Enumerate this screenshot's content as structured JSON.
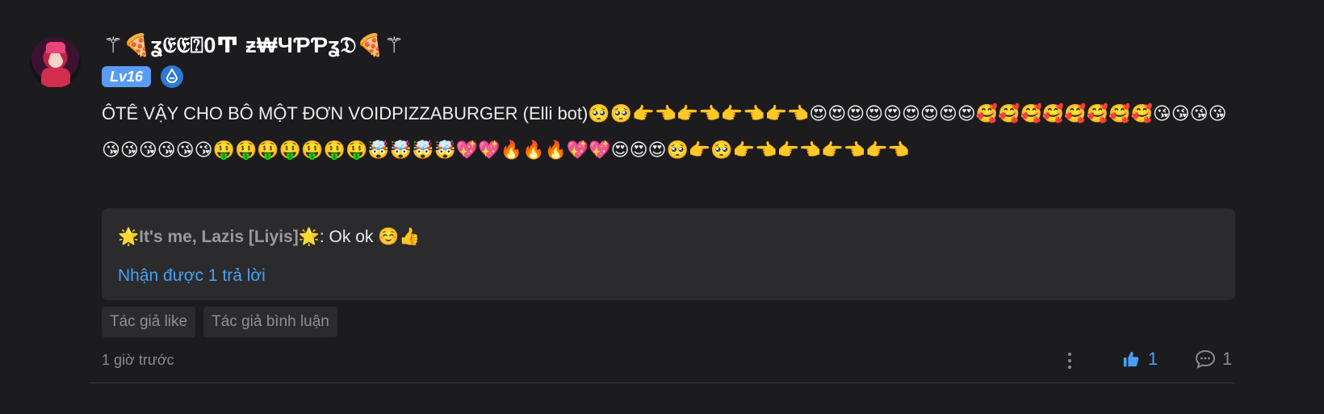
{
  "comment": {
    "username": "⚚🍕ʓ𝔈𝔈⍰0Ͳ ƶ₩ЧƤƤʓ𝔇🍕⚚",
    "level": "Lv16",
    "content": "ÔTÊ VẬY CHO BÔ MỘT ĐƠN VOIDPIZZABURGER (Elli bot)🥺🥺👉👈👉👈👉👈👉👈😍😍😍😍😍😍😍😍😍🥰🥰🥰🥰🥰🥰🥰🥰😘😘😘😘😘😘😘😘😘😘🤑🤑🤑🤑🤑🤑🤑🤯🤯🤯🤯💖💖🔥🔥🔥💖💖😍😍😍🥺👉🥺👉👈👉👈👉👈👉👈",
    "quote": {
      "author": "🌟It's me, Lazis [Liyis]🌟",
      "separator": ": ",
      "text": "Ok ok ☺️👍",
      "replies_link": "Nhận được 1 trả lời"
    },
    "tags": [
      "Tác giả like",
      "Tác giả bình luận"
    ],
    "time": "1 giờ trước",
    "likes": "1",
    "replies": "1"
  },
  "icons": {
    "verified": "verified-icon",
    "more": "more-dots-icon",
    "like": "thumbs-up-icon",
    "reply": "comment-bubble-icon"
  },
  "colors": {
    "background": "#1c1c1e",
    "accent": "#4a9ff2",
    "level_badge": "#5a9cf5",
    "quote_bg": "#2b2b2e"
  }
}
